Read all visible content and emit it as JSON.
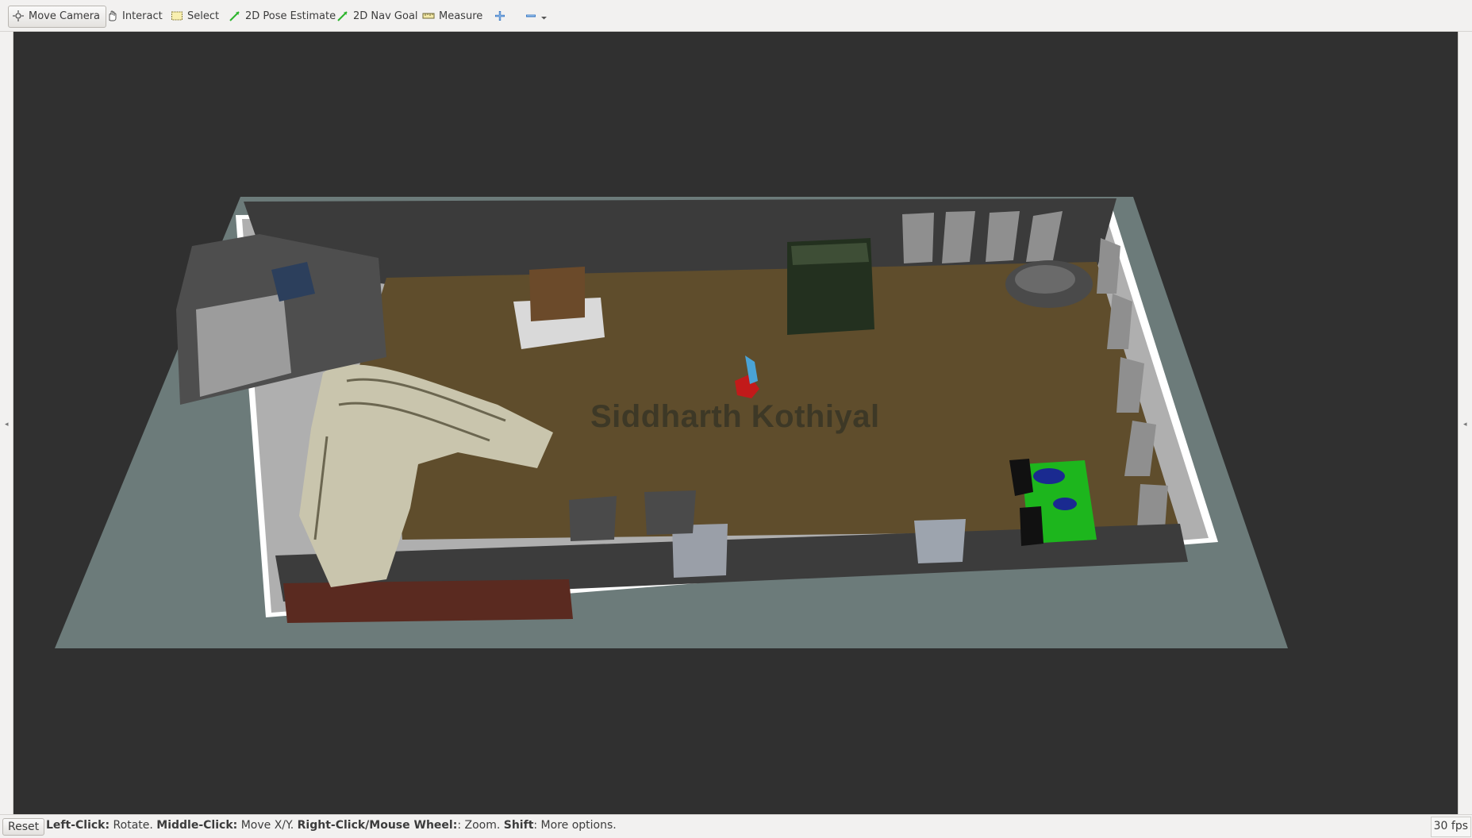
{
  "toolbar": {
    "tools": [
      {
        "label": "Move Camera",
        "icon": "move-camera-icon",
        "active": true
      },
      {
        "label": "Interact",
        "icon": "hand-icon"
      },
      {
        "label": "Select",
        "icon": "select-rect-icon"
      },
      {
        "label": "2D Pose Estimate",
        "icon": "green-arrow-icon"
      },
      {
        "label": "2D Nav Goal",
        "icon": "green-arrow-icon"
      },
      {
        "label": "Measure",
        "icon": "ruler-icon"
      }
    ],
    "add_tool_icon": "plus-cross-icon",
    "remove_tool_icon": "minus-icon",
    "dropdown_icon": "chevron-down-icon"
  },
  "viewport": {
    "overlay_text": "Siddharth Kothiyal",
    "background_color": "#303030",
    "grid_plane_color": "#6c7b7a",
    "floor_color": "#5f4d2c"
  },
  "statusbar": {
    "reset_label": "Reset",
    "hint_parts": [
      {
        "key": "Left-Click:",
        "text": " Rotate. "
      },
      {
        "key": "Middle-Click:",
        "text": " Move X/Y. "
      },
      {
        "key": "Right-Click/Mouse Wheel:",
        "text": ": Zoom. "
      },
      {
        "key": "Shift",
        "text": ": More options."
      }
    ],
    "fps": "30 fps"
  }
}
